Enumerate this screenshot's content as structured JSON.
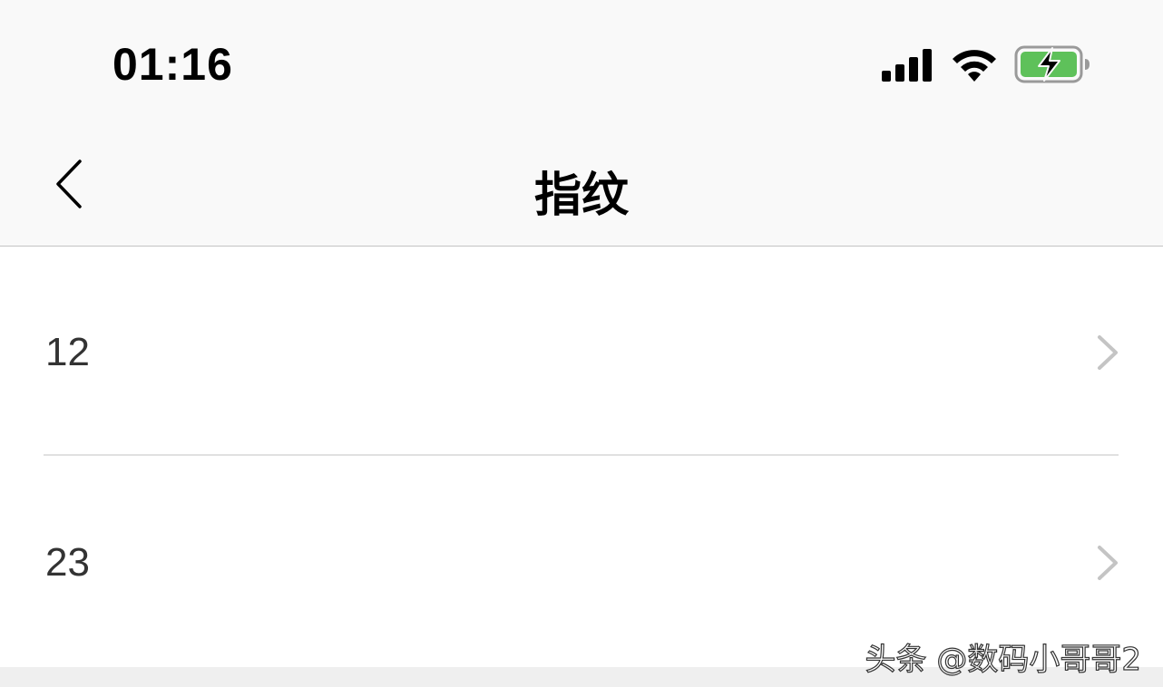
{
  "status_bar": {
    "time": "01:16",
    "icons": [
      "cellular-signal-icon",
      "wifi-icon",
      "battery-charging-icon"
    ],
    "battery_color": "#5ec15a"
  },
  "nav": {
    "back_icon": "chevron-left-icon",
    "title": "指纹"
  },
  "fingerprints": [
    {
      "label": "12",
      "chevron_icon": "chevron-right-icon"
    },
    {
      "label": "23",
      "chevron_icon": "chevron-right-icon"
    }
  ],
  "watermark": "头条 @数码小哥哥2"
}
